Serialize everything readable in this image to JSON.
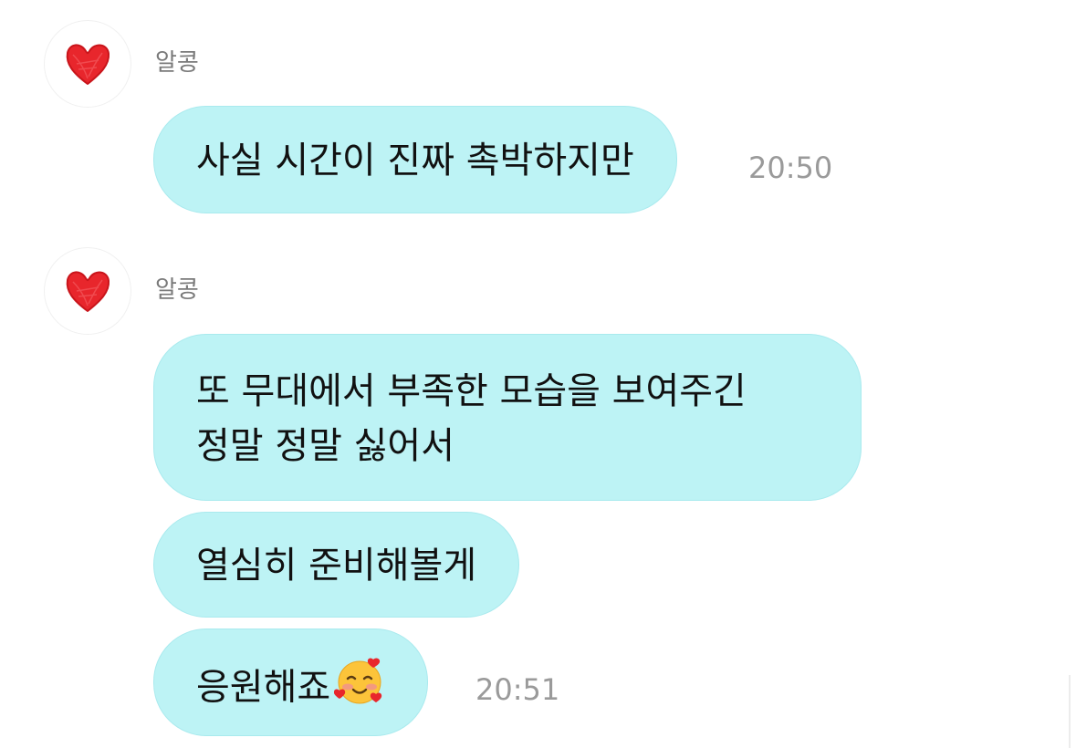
{
  "chat": {
    "groups": [
      {
        "sender": "알콩",
        "messages": [
          {
            "lines": [
              "사실 시간이 진짜 촉박하지만"
            ],
            "time": "20:50"
          }
        ]
      },
      {
        "sender": "알콩",
        "messages": [
          {
            "lines": [
              "또 무대에서 부족한 모습을 보여주긴",
              "정말 정말 싫어서"
            ],
            "time": ""
          },
          {
            "lines": [
              "열심히 준비해볼게"
            ],
            "time": ""
          },
          {
            "lines": [
              "응원해죠"
            ],
            "emoji": "smiling-face-with-hearts-icon",
            "time": "20:51"
          }
        ]
      }
    ],
    "colors": {
      "bubble": "#bdf3f5",
      "heart": "#e8262c",
      "time_text": "#9a9a9a",
      "name_text": "#7a7a7a"
    }
  }
}
